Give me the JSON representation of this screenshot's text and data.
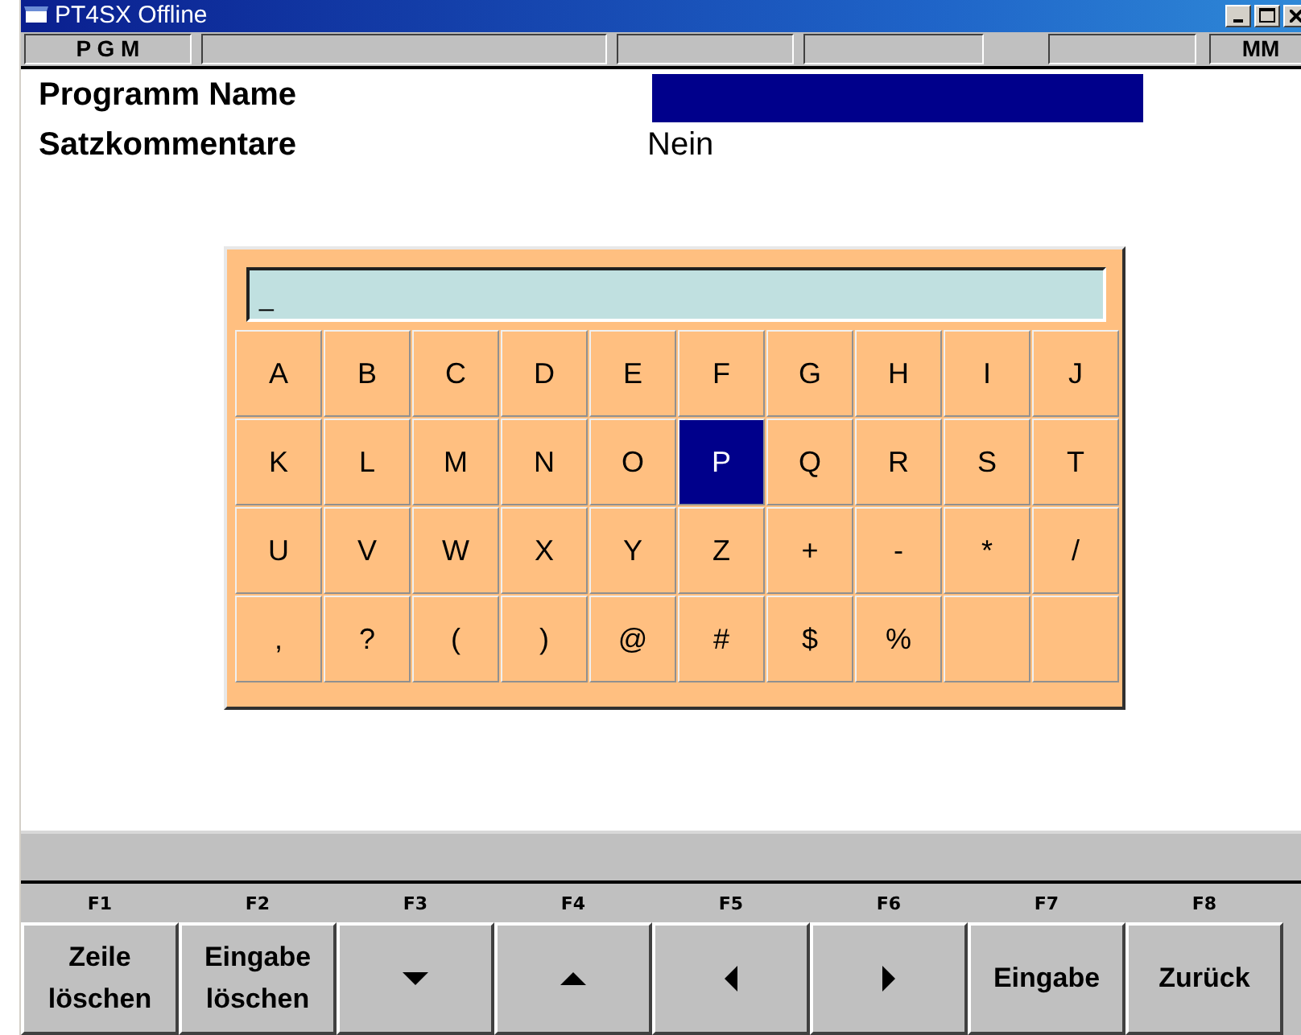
{
  "window": {
    "title": "PT4SX Offline"
  },
  "status_fields": [
    {
      "kind": "label",
      "text": "P G M"
    },
    {
      "kind": "blank"
    },
    {
      "kind": "blank"
    },
    {
      "kind": "blank"
    },
    {
      "kind": "blank"
    },
    {
      "kind": "label",
      "text": "MM"
    }
  ],
  "program_name": {
    "label": "Programm Name",
    "selected": true
  },
  "comments": {
    "label": "Satzkommentare",
    "value": "Nein"
  },
  "keyboard": {
    "input": {
      "value": "_"
    },
    "keys": [
      {
        "kind": "char",
        "text": "A",
        "selected": false
      },
      {
        "kind": "char",
        "text": "B",
        "selected": false
      },
      {
        "kind": "char",
        "text": "C",
        "selected": false
      },
      {
        "kind": "char",
        "text": "D",
        "selected": false
      },
      {
        "kind": "char",
        "text": "E",
        "selected": false
      },
      {
        "kind": "char",
        "text": "F",
        "selected": false
      },
      {
        "kind": "char",
        "text": "G",
        "selected": false
      },
      {
        "kind": "char",
        "text": "H",
        "selected": false
      },
      {
        "kind": "char",
        "text": "I",
        "selected": false
      },
      {
        "kind": "char",
        "text": "J",
        "selected": false
      },
      {
        "kind": "char",
        "text": "K",
        "selected": false
      },
      {
        "kind": "char",
        "text": "L",
        "selected": false
      },
      {
        "kind": "char",
        "text": "M",
        "selected": false
      },
      {
        "kind": "char",
        "text": "N",
        "selected": false
      },
      {
        "kind": "char",
        "text": "O",
        "selected": false
      },
      {
        "kind": "char",
        "text": "P",
        "selected": true
      },
      {
        "kind": "char",
        "text": "Q",
        "selected": false
      },
      {
        "kind": "char",
        "text": "R",
        "selected": false
      },
      {
        "kind": "char",
        "text": "S",
        "selected": false
      },
      {
        "kind": "char",
        "text": "T",
        "selected": false
      },
      {
        "kind": "char",
        "text": "U",
        "selected": false
      },
      {
        "kind": "char",
        "text": "V",
        "selected": false
      },
      {
        "kind": "char",
        "text": "W",
        "selected": false
      },
      {
        "kind": "char",
        "text": "X",
        "selected": false
      },
      {
        "kind": "char",
        "text": "Y",
        "selected": false
      },
      {
        "kind": "char",
        "text": "Z",
        "selected": false
      },
      {
        "kind": "char",
        "text": "+",
        "selected": false
      },
      {
        "kind": "char",
        "text": "-",
        "selected": false
      },
      {
        "kind": "char",
        "text": "*",
        "selected": false
      },
      {
        "kind": "char",
        "text": "/",
        "selected": false
      },
      {
        "kind": "char",
        "text": ",",
        "selected": false
      },
      {
        "kind": "char",
        "text": "?",
        "selected": false
      },
      {
        "kind": "char",
        "text": "(",
        "selected": false
      },
      {
        "kind": "char",
        "text": ")",
        "selected": false
      },
      {
        "kind": "char",
        "text": "@",
        "selected": false
      },
      {
        "kind": "char",
        "text": "#",
        "selected": false
      },
      {
        "kind": "char",
        "text": "$",
        "selected": false
      },
      {
        "kind": "char",
        "text": "%",
        "selected": false
      },
      {
        "kind": "blank",
        "selected": false
      },
      {
        "kind": "blank",
        "selected": false
      }
    ]
  },
  "function_keys": [
    {
      "key": "F1",
      "kind": "text",
      "label": "Zeile löschen"
    },
    {
      "key": "F2",
      "kind": "text",
      "label": "Eingabe löschen"
    },
    {
      "key": "F3",
      "kind": "down"
    },
    {
      "key": "F4",
      "kind": "up"
    },
    {
      "key": "F5",
      "kind": "left"
    },
    {
      "key": "F6",
      "kind": "right"
    },
    {
      "key": "F7",
      "kind": "text",
      "label": "Eingabe"
    },
    {
      "key": "F8",
      "kind": "text",
      "label": "Zurück"
    }
  ]
}
